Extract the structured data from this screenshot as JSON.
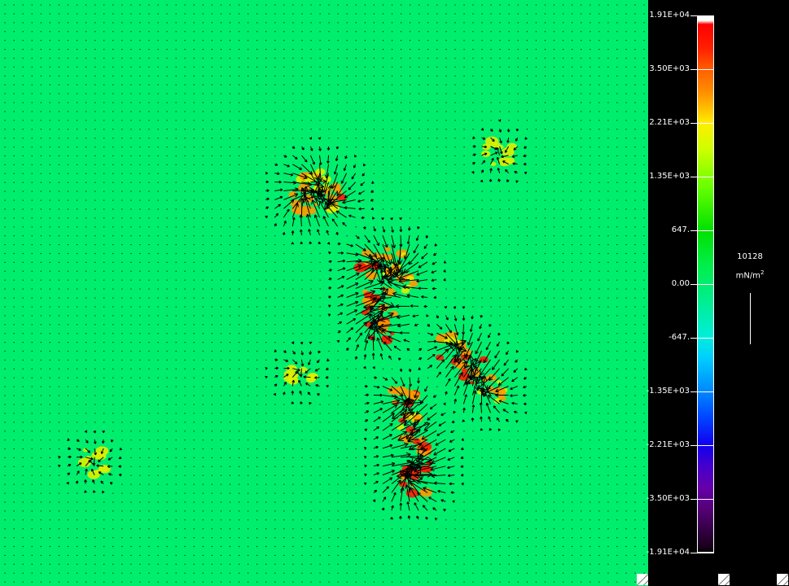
{
  "chart_data": {
    "type": "vector-field",
    "grid": {
      "cols": 72,
      "rows": 66,
      "x_range": [
        0,
        71
      ],
      "y_range": [
        0,
        65
      ]
    },
    "background_color": "#00ee6e",
    "arrow_color": "#000000",
    "colorbar": {
      "max_label": "1.91E+04",
      "min_label": "-1.91E+04",
      "labels": [
        "1.91E+04",
        "3.50E+03",
        "2.21E+03",
        "1.35E+03",
        "647.",
        "0.00",
        "-647.",
        "-1.35E+03",
        "-2.21E+03",
        "-3.50E+03",
        "-1.91E+04"
      ],
      "colors": [
        "#ff0000",
        "#ff8c00",
        "#ffee00",
        "#66ff00",
        "#00e000",
        "#00ee6e",
        "#00eedd",
        "#0088ff",
        "#1100ee",
        "#6600aa",
        "#000000"
      ]
    },
    "reference_vector": {
      "value": "10128",
      "unit": "mN/m^2"
    },
    "hotspots": [
      {
        "x": 34.7,
        "y": 20.3,
        "value": 0.6
      },
      {
        "x": 37.0,
        "y": 22.3,
        "value": 0.8
      },
      {
        "x": 33.8,
        "y": 22.7,
        "value": 0.7
      },
      {
        "x": 41.2,
        "y": 30.0,
        "value": 1.0
      },
      {
        "x": 41.8,
        "y": 34.0,
        "value": 0.9
      },
      {
        "x": 42.3,
        "y": 36.8,
        "value": 1.0
      },
      {
        "x": 44.0,
        "y": 29.5,
        "value": 0.7
      },
      {
        "x": 44.5,
        "y": 31.4,
        "value": 0.6
      },
      {
        "x": 50.3,
        "y": 39.2,
        "value": 0.8
      },
      {
        "x": 52.5,
        "y": 41.8,
        "value": 0.9
      },
      {
        "x": 54.5,
        "y": 44.0,
        "value": 0.6
      },
      {
        "x": 44.7,
        "y": 45.5,
        "value": 0.9
      },
      {
        "x": 46.0,
        "y": 48.5,
        "value": 0.8
      },
      {
        "x": 46.5,
        "y": 51.8,
        "value": 0.9
      },
      {
        "x": 45.8,
        "y": 54.0,
        "value": 1.0
      },
      {
        "x": 33.3,
        "y": 42.0,
        "value": 0.3
      },
      {
        "x": 10.3,
        "y": 52.0,
        "value": 0.3
      },
      {
        "x": 55.5,
        "y": 17.4,
        "value": 0.3
      }
    ]
  }
}
